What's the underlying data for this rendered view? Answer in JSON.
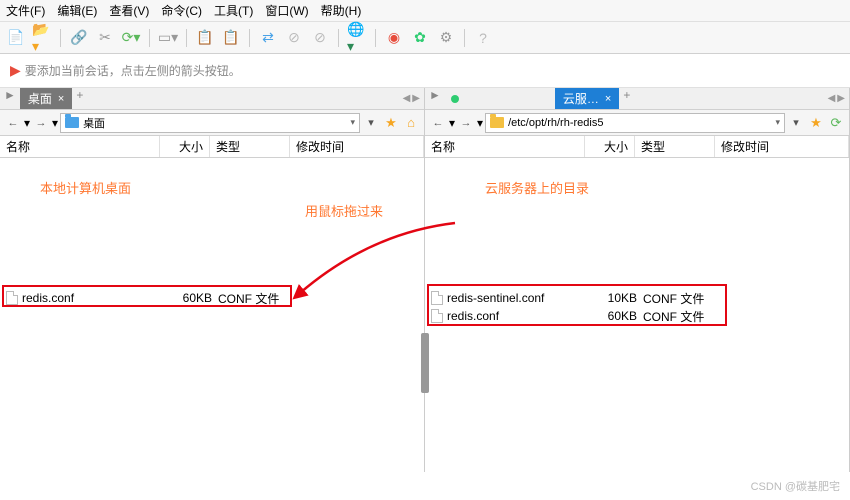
{
  "menu": {
    "items": [
      "文件(F)",
      "编辑(E)",
      "查看(V)",
      "命令(C)",
      "工具(T)",
      "窗口(W)",
      "帮助(H)"
    ]
  },
  "hint": {
    "text": "要添加当前会话，点击左侧的箭头按钮。"
  },
  "left": {
    "tab": "桌面",
    "path": "桌面",
    "annotation": "本地计算机桌面",
    "cols": {
      "name": "名称",
      "size": "大小",
      "type": "类型",
      "date": "修改时间"
    },
    "file": {
      "name": "redis.conf",
      "size": "60KB",
      "type": "CONF 文件"
    }
  },
  "right": {
    "tab": "云服…",
    "path": "/etc/opt/rh/rh-redis5",
    "annotation": "云服务器上的目录",
    "cols": {
      "name": "名称",
      "size": "大小",
      "type": "类型",
      "date": "修改时间"
    },
    "files": [
      {
        "name": "redis-sentinel.conf",
        "size": "10KB",
        "type": "CONF 文件"
      },
      {
        "name": "redis.conf",
        "size": "60KB",
        "type": "CONF 文件"
      }
    ]
  },
  "arrow_label": "用鼠标拖过来",
  "watermark": "CSDN @碳基肥宅"
}
